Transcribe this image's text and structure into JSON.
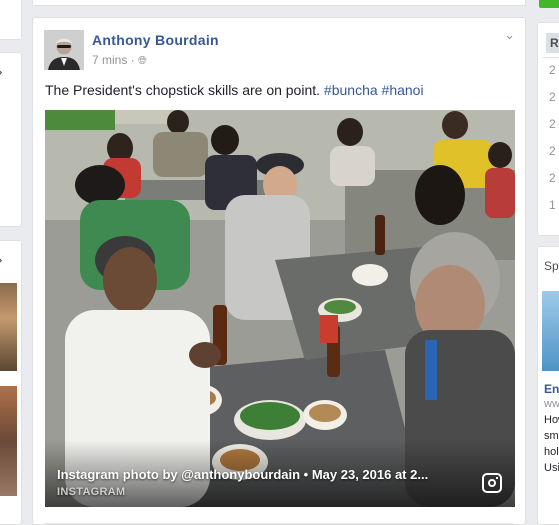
{
  "post": {
    "author": "Anthony Bourdain",
    "time": "7 mins",
    "privacy_icon": "globe-icon",
    "menu_icon": "chevron-down-icon",
    "text_plain": "The President's chopstick skills are on point. ",
    "hashtag1": "#buncha",
    "hashtag2": "#hanoi",
    "photo_caption": "Instagram photo by @anthonybourdain • May 23, 2016 at 2...",
    "photo_source": "INSTAGRAM",
    "source_icon": "instagram-icon"
  },
  "right_sidebar": {
    "header_partial": "R",
    "numbers": [
      "2",
      "2",
      "2",
      "2",
      "2",
      "1"
    ],
    "section_partial": "Spo",
    "ad_title_partial": "Enjo",
    "ad_url_partial": "www",
    "ad_text_lines": [
      "How",
      "sma",
      "holic",
      "Usin"
    ]
  },
  "left_sidebar": {
    "chevron_icon": "chevron-right-icon"
  },
  "colors": {
    "link": "#365899",
    "meta": "#90949c",
    "background": "#e9ebee",
    "green_button": "#42b72a"
  }
}
